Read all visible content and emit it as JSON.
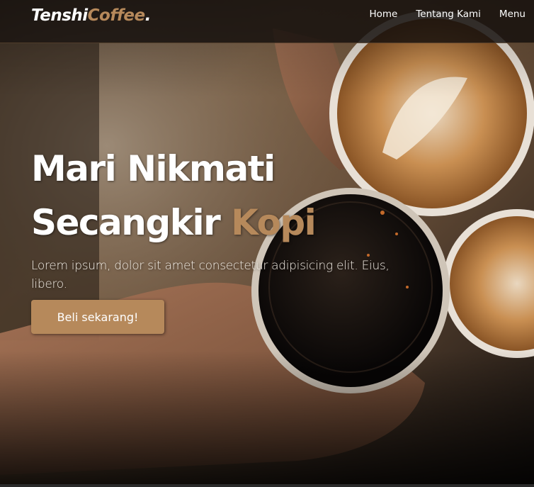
{
  "brand": {
    "name": "Tenshi",
    "accent": "Coffee",
    "dot": "."
  },
  "nav": {
    "items": [
      {
        "label": "Home"
      },
      {
        "label": "Tentang Kami"
      },
      {
        "label": "Menu"
      }
    ]
  },
  "hero": {
    "line1": "Mari Nikmati",
    "line2_main": "Secangkir ",
    "line2_accent": "Kopi",
    "description": "Lorem ipsum, dolor sit amet consectetur adipisicing elit. Eius, libero.",
    "cta_label": "Beli sekarang!"
  },
  "colors": {
    "accent": "#b6895b",
    "navbar": "#140f0c",
    "text": "#ffffff"
  }
}
